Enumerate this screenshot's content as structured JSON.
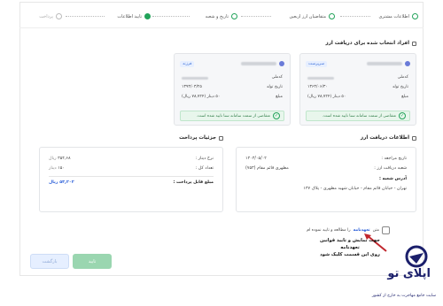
{
  "stepper": {
    "steps": [
      {
        "label": "اطلاعات مشتری",
        "state": "done"
      },
      {
        "label": "متقاضیان ارز اربعین",
        "state": "done"
      },
      {
        "label": "تاریخ و شعبه",
        "state": "done"
      },
      {
        "label": "تایید اطلاعات",
        "state": "current"
      },
      {
        "label": "پرداخت",
        "state": "pending"
      }
    ]
  },
  "applicants": {
    "title": "افراد انتخاب شده برای دریافت ارز",
    "cards": [
      {
        "role": "سرپرست",
        "national_code_label": "کدملی",
        "birth_label": "تاریخ تولد",
        "birth_value": "۱۳۶۳/۰۶/۳۰",
        "amount_label": "مبلغ",
        "amount_value": "۵۰ دینار (۷۸,۷۲۴ ریال)",
        "approved_text": "متقاضی از سمت سامانه سنا تایید شده است."
      },
      {
        "role": "فرزند",
        "national_code_label": "کدملی",
        "birth_label": "تاریخ تولد",
        "birth_value": "۱۳۹۳/۰۳/۲۵",
        "amount_label": "مبلغ",
        "amount_value": "۵۰ دینار (۷۸,۷۲۴ ریال)",
        "approved_text": "متقاضی از سمت سامانه سنا تایید شده است."
      }
    ]
  },
  "receipt": {
    "title": "اطلاعات دریافت ارز",
    "visit_date_label": "تاریخ مراجعه :",
    "visit_date_value": "۱۴۰۳/۰۵/۰۲",
    "branch_label": "شعبه دریافت ارز :",
    "branch_value": "مطهری قائم مقام (۷۵۳)",
    "address_label": "آدرس شعبه :",
    "address_value": "تهران - خیابان قائم مقام - خیابان شهید مطهری - پلاک ۱۳۷"
  },
  "payment": {
    "title": "جزئیات پرداخت",
    "rate_label": "نرخ دینار :",
    "rate_value": "۳۵۴,۶۸",
    "rate_unit": "ریال",
    "count_label": "تعداد کل :",
    "count_value": "۱۵۰",
    "count_unit": "دینار",
    "total_label": "مبلغ قابل پرداخت :",
    "total_value": "۵۳,۲۰۲",
    "total_unit": "ریال"
  },
  "terms": {
    "prefix": "متن",
    "link": "تعهدنامه",
    "suffix": "را مطالعه و تایید نموده ام",
    "hint_line1": "جهت نمایش و تایید قوانین تعهدنامه",
    "hint_line2": "روی این قسمت کلیک شود"
  },
  "buttons": {
    "confirm": "تایید",
    "back": "بازگشت"
  },
  "watermark": {
    "brand": "اپلای تو",
    "tagline": "سایت جامع مهاجرت به خارج از کشور"
  },
  "colors": {
    "accent_green": "#22a35a",
    "link_blue": "#2b5fd9",
    "annotation_red": "#c0262d"
  }
}
